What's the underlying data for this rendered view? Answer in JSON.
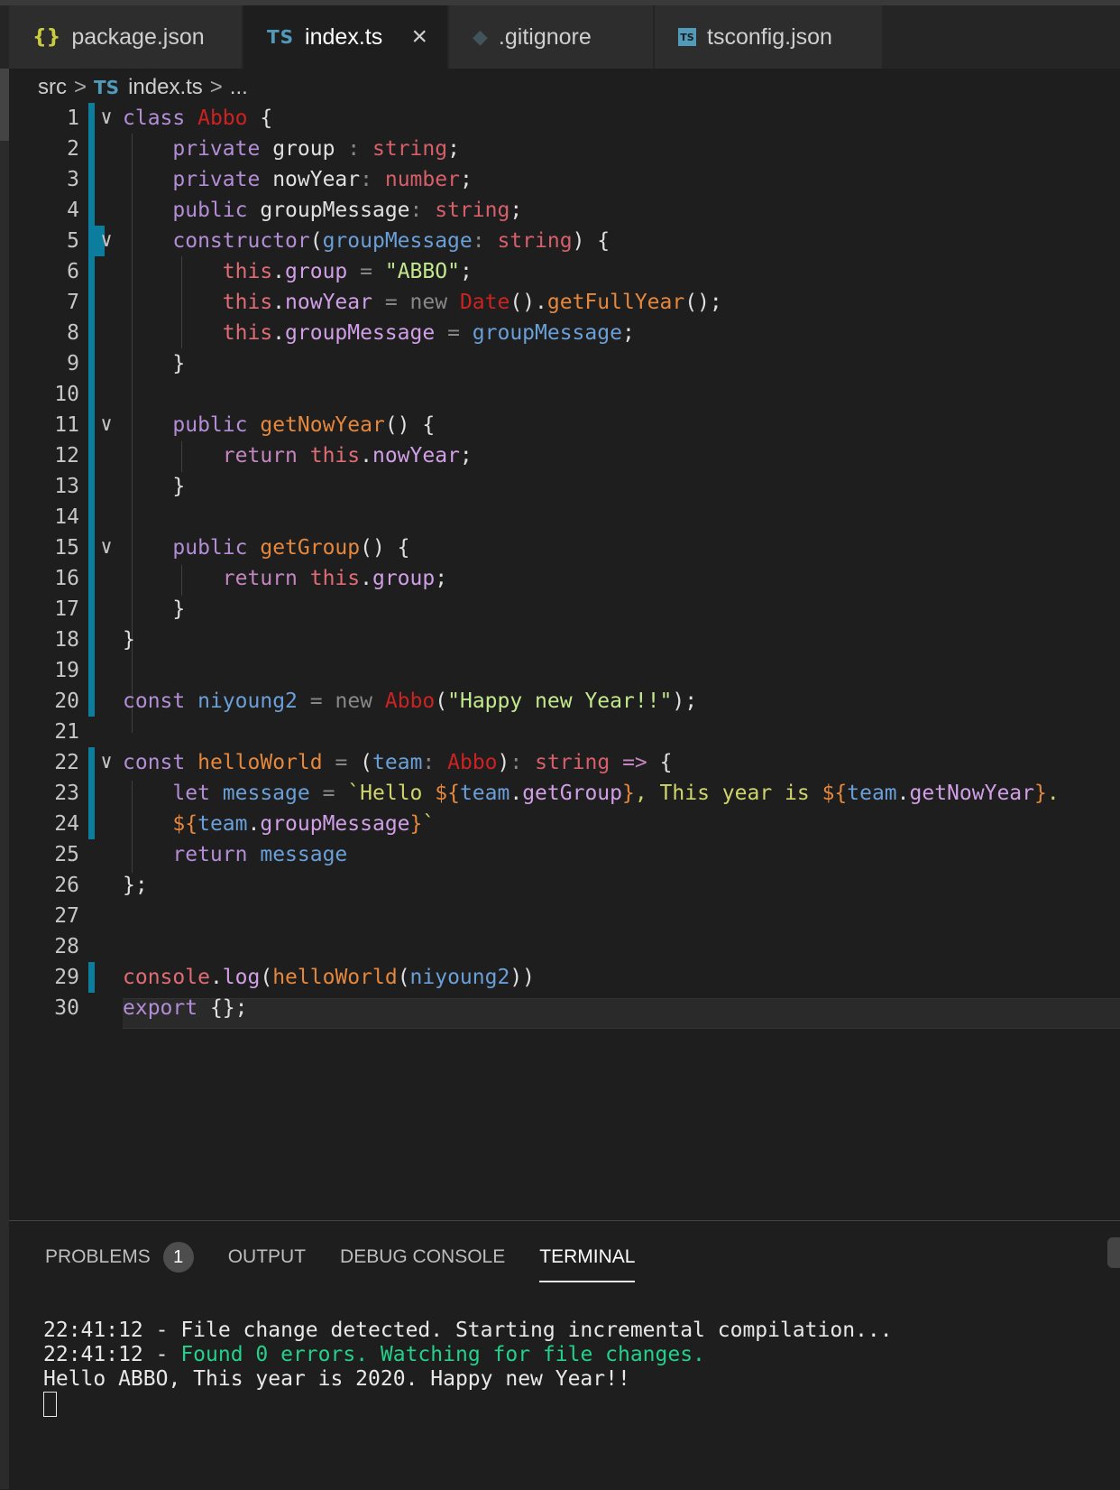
{
  "tabs": [
    {
      "icon": "{}",
      "label": "package.json"
    },
    {
      "icon": "TS",
      "label": "index.ts",
      "close": "×"
    },
    {
      "icon": "◆",
      "label": ".gitignore"
    },
    {
      "icon": "TS",
      "label": "tsconfig.json"
    }
  ],
  "breadcrumb": {
    "folder": "src",
    "sep": ">",
    "file_icon": "TS",
    "file": "index.ts",
    "more": "..."
  },
  "editor": {
    "line_numbers": [
      "1",
      "2",
      "3",
      "4",
      "5",
      "6",
      "7",
      "8",
      "9",
      "10",
      "11",
      "12",
      "13",
      "14",
      "15",
      "16",
      "17",
      "18",
      "19",
      "20",
      "21",
      "22",
      "23",
      "24",
      "25",
      "26",
      "27",
      "28",
      "29",
      "30"
    ],
    "fold_glyph": "∨"
  },
  "panel": {
    "tabs": [
      {
        "label": "PROBLEMS",
        "badge": "1"
      },
      {
        "label": "OUTPUT"
      },
      {
        "label": "DEBUG CONSOLE"
      },
      {
        "label": "TERMINAL"
      }
    ],
    "terminal": {
      "line1": "22:41:12 - File change detected. Starting incremental compilation...",
      "line2_prefix": "22:41:12 - ",
      "line2_status": "Found 0 errors. Watching for file changes.",
      "line3": "Hello ABBO, This year is 2020. Happy new Year!!"
    }
  }
}
